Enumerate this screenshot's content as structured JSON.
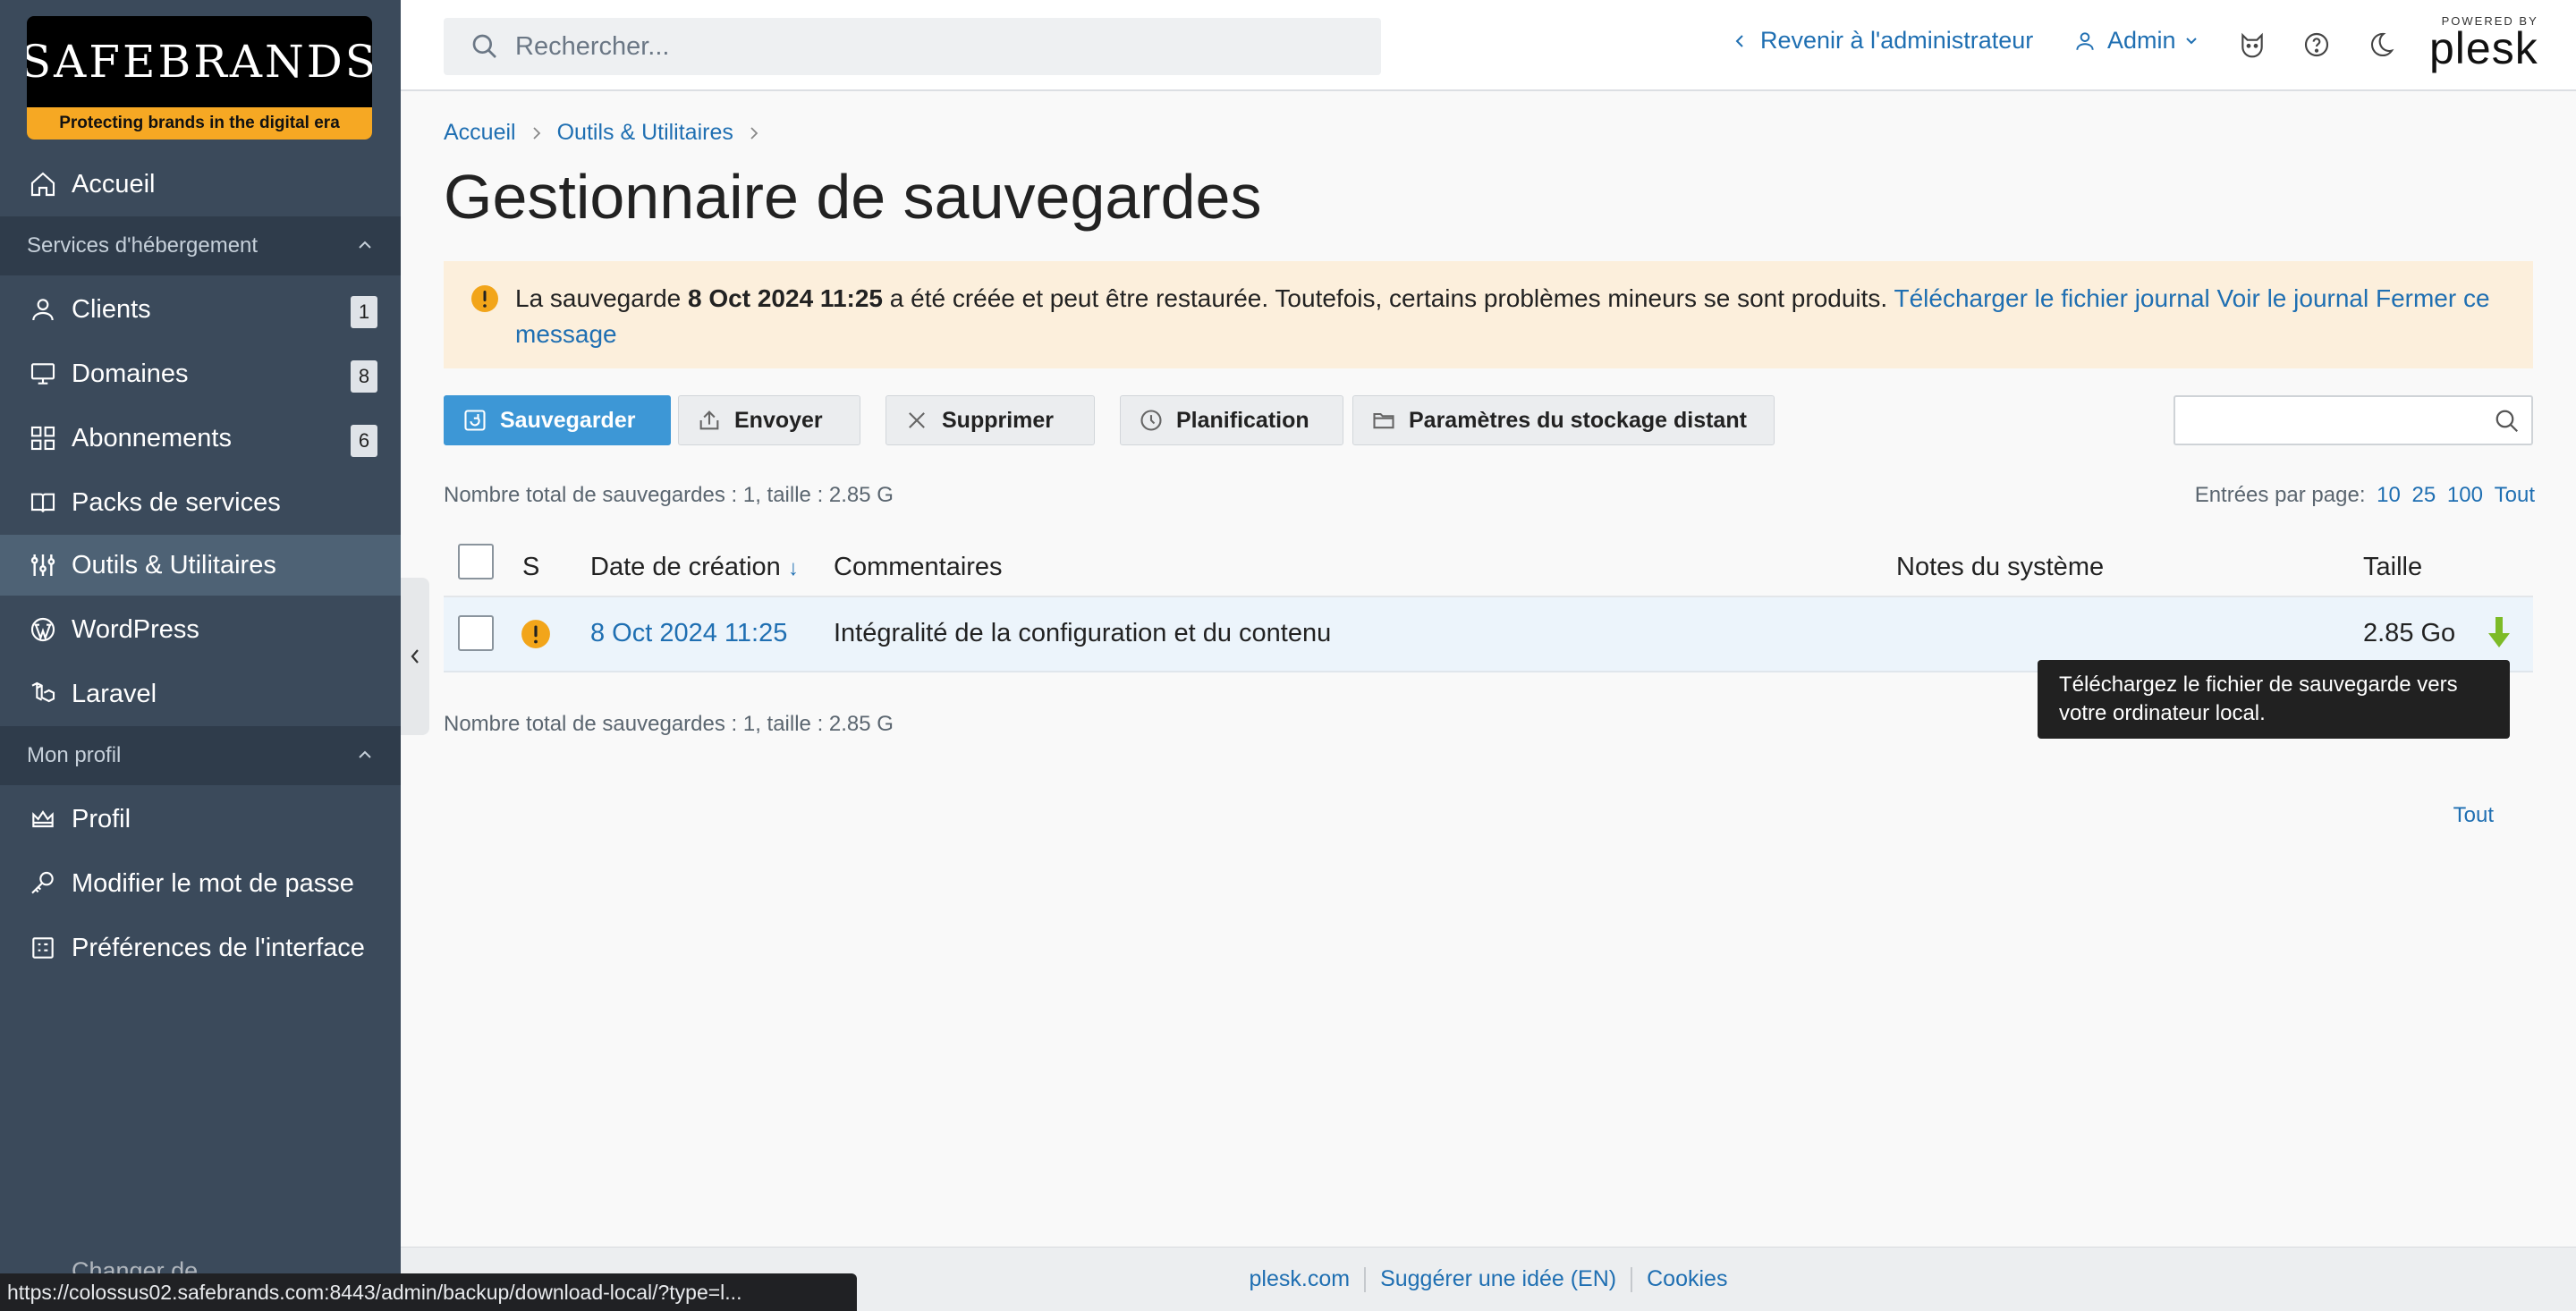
{
  "brand": {
    "name": "SAFEBRANDS",
    "tagline": "Protecting brands in the digital era"
  },
  "sidebar": {
    "home": "Accueil",
    "section_hosting": "Services d'hébergement",
    "items_hosting": [
      {
        "label": "Clients",
        "badge": "1",
        "icon": "user-icon"
      },
      {
        "label": "Domaines",
        "badge": "8",
        "icon": "monitor-icon"
      },
      {
        "label": "Abonnements",
        "badge": "6",
        "icon": "grid-icon"
      },
      {
        "label": "Packs de services",
        "icon": "book-icon"
      },
      {
        "label": "Outils & Utilitaires",
        "icon": "sliders-icon",
        "active": true
      },
      {
        "label": "WordPress",
        "icon": "wordpress-icon"
      },
      {
        "label": "Laravel",
        "icon": "laravel-icon"
      }
    ],
    "section_profile": "Mon profil",
    "items_profile": [
      {
        "label": "Profil",
        "icon": "crown-icon"
      },
      {
        "label": "Modifier le mot de passe",
        "icon": "key-icon"
      },
      {
        "label": "Préférences de l'interface",
        "icon": "preferences-icon"
      }
    ],
    "hidden_bottom": "Changer de..."
  },
  "header": {
    "search_placeholder": "Rechercher...",
    "back_admin": "Revenir à l'administrateur",
    "user": "Admin",
    "powered_by": "POWERED BY",
    "plesk": "plesk"
  },
  "breadcrumb": [
    "Accueil",
    "Outils & Utilitaires"
  ],
  "page": {
    "title": "Gestionnaire de sauvegardes"
  },
  "alert": {
    "prefix": "La sauvegarde ",
    "date": "8 Oct 2024 11:25",
    "text": " a été créée et peut être restaurée. Toutefois, certains problèmes mineurs se sont produits. ",
    "link_download": "Télécharger le fichier journal",
    "link_view": "Voir le journal",
    "link_close": "Fermer ce message"
  },
  "toolbar": {
    "backup": "Sauvegarder",
    "upload": "Envoyer",
    "delete": "Supprimer",
    "schedule": "Planification",
    "remote": "Paramètres du stockage distant"
  },
  "summary": "Nombre total de sauvegardes : 1, taille : 2.85 G",
  "per_page": {
    "label": "Entrées par page:",
    "options": [
      "10",
      "25",
      "100",
      "Tout"
    ]
  },
  "table": {
    "columns": {
      "s": "S",
      "date": "Date de création",
      "sort": "↓",
      "comments": "Commentaires",
      "notes": "Notes du système",
      "size": "Taille"
    },
    "rows": [
      {
        "date": "8 Oct 2024 11:25",
        "comment": "Intégralité de la configuration et du contenu",
        "notes": "",
        "size": "2.85 Go"
      }
    ]
  },
  "tooltip": "Téléchargez le fichier de sauvegarde vers votre ordinateur local.",
  "footer": {
    "links": [
      "plesk.com",
      "Suggérer une idée (EN)",
      "Cookies"
    ]
  },
  "statusbar": "https://colossus02.safebrands.com:8443/admin/backup/download-local/?type=l..."
}
